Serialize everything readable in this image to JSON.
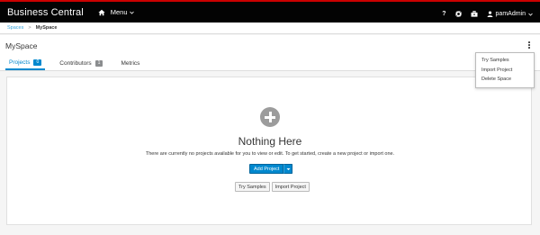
{
  "app": {
    "brand": "Business Central",
    "menu_label": "Menu",
    "user_name": "pamAdmin"
  },
  "icons": {
    "home": "home-icon",
    "help": "help-icon",
    "settings": "gear-icon",
    "tasks": "briefcase-icon",
    "user": "user-icon",
    "caret": "chevron-down-icon",
    "kebab": "kebab-icon",
    "empty": "plus-circle-icon"
  },
  "breadcrumb": {
    "root": "Spaces",
    "separator": ">",
    "current": "MySpace"
  },
  "page": {
    "title": "MySpace"
  },
  "tabs": [
    {
      "label": "Projects",
      "count": "0",
      "active": true
    },
    {
      "label": "Contributors",
      "count": "1",
      "active": false
    },
    {
      "label": "Metrics",
      "count": null,
      "active": false
    }
  ],
  "kebab_menu": {
    "items": [
      "Try Samples",
      "Import Project",
      "Delete Space"
    ]
  },
  "empty_state": {
    "title": "Nothing Here",
    "text": "There are currently no projects available for you to view or edit. To get started, create a new project or import one.",
    "primary_button": "Add Project",
    "secondary_buttons": [
      "Try Samples",
      "Import Project"
    ]
  },
  "colors": {
    "topbar": "#030303",
    "accent_red": "#cc0000",
    "primary": "#0088ce",
    "link": "#39a5dc"
  }
}
